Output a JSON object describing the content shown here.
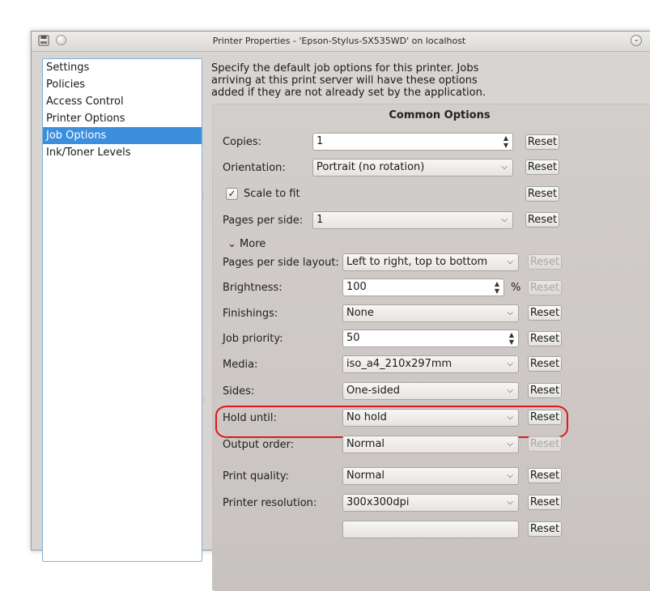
{
  "window": {
    "title": "Printer Properties - 'Epson-Stylus-SX535WD' on localhost",
    "menu_glyph": "⌄"
  },
  "sidebar": {
    "items": [
      {
        "label": "Settings"
      },
      {
        "label": "Policies"
      },
      {
        "label": "Access Control"
      },
      {
        "label": "Printer Options"
      },
      {
        "label": "Job Options",
        "selected": true
      },
      {
        "label": "Ink/Toner Levels"
      }
    ]
  },
  "description": "Specify the default job options for this printer.  Jobs arriving at this print server will have these options added if they are not already set by the application.",
  "common": {
    "title": "Common Options",
    "copies": {
      "label": "Copies:",
      "value": "1"
    },
    "orientation": {
      "label": "Orientation:",
      "value": "Portrait (no rotation)"
    },
    "scale_to_fit": {
      "label": "Scale to fit",
      "checked": true,
      "check_glyph": "✓"
    },
    "pages_per_side": {
      "label": "Pages per side:",
      "value": "1"
    },
    "more": {
      "label": "More",
      "glyph": "⌄"
    },
    "reset_label": "Reset"
  },
  "advanced": {
    "pages_per_side_layout": {
      "label": "Pages per side layout:",
      "value": "Left to right, top to bottom"
    },
    "brightness": {
      "label": "Brightness:",
      "value": "100",
      "unit": "%"
    },
    "finishings": {
      "label": "Finishings:",
      "value": "None"
    },
    "job_priority": {
      "label": "Job priority:",
      "value": "50"
    },
    "media": {
      "label": "Media:",
      "value": "iso_a4_210x297mm"
    },
    "sides": {
      "label": "Sides:",
      "value": "One-sided"
    },
    "hold_until": {
      "label": "Hold until:",
      "value": "No hold"
    },
    "output_order": {
      "label": "Output order:",
      "value": "Normal"
    },
    "print_quality": {
      "label": "Print quality:",
      "value": "Normal"
    },
    "printer_resolution": {
      "label": "Printer resolution:",
      "value": "300x300dpi"
    }
  },
  "colors": {
    "selection": "#3b8fdc",
    "highlight_ring": "#e3151a"
  }
}
